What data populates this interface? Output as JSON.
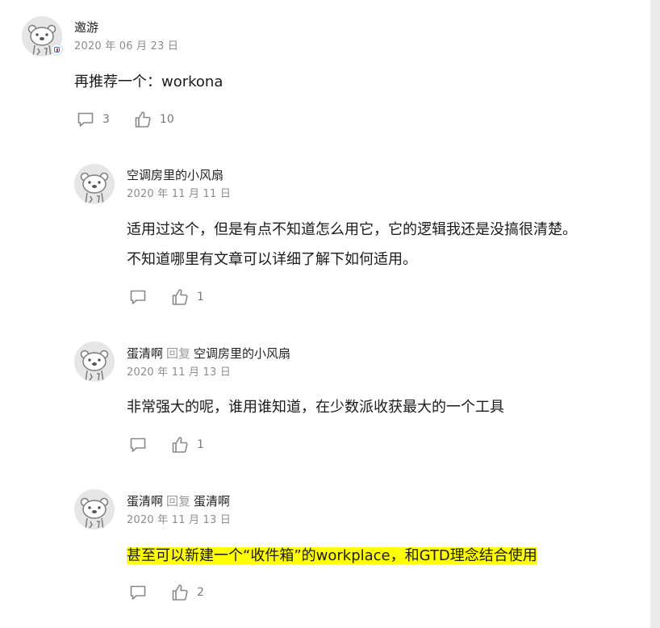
{
  "comments": [
    {
      "author": "邀游",
      "date": "2020 年 06 月 23 日",
      "lines": [
        "再推荐一个：workona"
      ],
      "comment_count": "3",
      "like_count": "10",
      "has_badge": true
    },
    {
      "author": "空调房里的小风扇",
      "date": "2020 年 11 月 11 日",
      "lines": [
        "适用过这个，但是有点不知道怎么用它，它的逻辑我还是没搞很清楚。",
        "不知道哪里有文章可以详细了解下如何适用。"
      ],
      "like_count": "1"
    },
    {
      "author": "蛋清啊",
      "reply_word": "回复",
      "reply_to": "空调房里的小风扇",
      "date": "2020 年 11 月 13 日",
      "lines": [
        "非常强大的呢，谁用谁知道，在少数派收获最大的一个工具"
      ],
      "like_count": "1"
    },
    {
      "author": "蛋清啊",
      "reply_word": "回复",
      "reply_to": "蛋清啊",
      "date": "2020 年 11 月 13 日",
      "lines": [
        "甚至可以新建一个“收件箱”的workplace，和GTD理念结合使用"
      ],
      "highlighted": true,
      "like_count": "2"
    }
  ],
  "colors": {
    "highlight": "#ffff00",
    "avatar_bg": "#e6e6e6",
    "icon_gray": "#888888",
    "badge_blue": "#2f6fd6",
    "badge_red": "#d93a2f"
  },
  "icons": {
    "comment": "comment-bubble-icon",
    "like": "thumbs-up-icon",
    "avatar": "otter-avatar-icon",
    "badge": "verified-badge-icon"
  }
}
